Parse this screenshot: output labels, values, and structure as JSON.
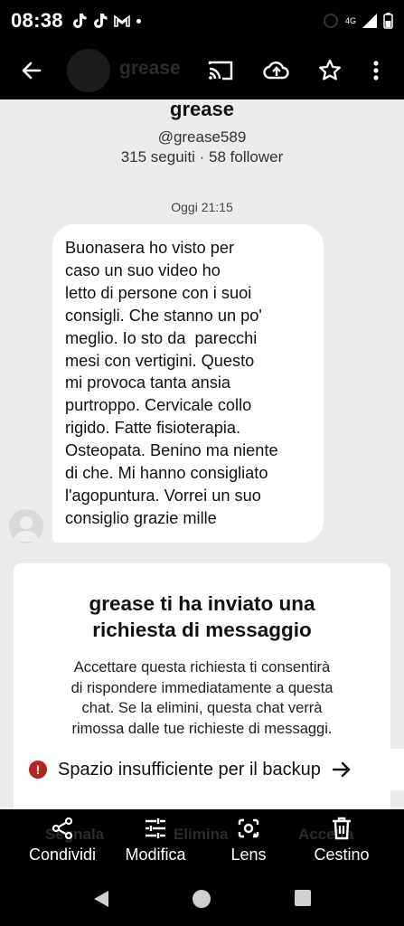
{
  "status_bar": {
    "time": "08:38",
    "left_icons": [
      "tiktok-icon",
      "tiktok-icon",
      "gmail-icon",
      "dot-icon"
    ],
    "network": "4G"
  },
  "top_bar": {
    "ghost_title": "grease",
    "icons": [
      "back-arrow-icon",
      "cast-icon",
      "cloud-upload-icon",
      "star-icon",
      "more-vert-icon"
    ]
  },
  "profile": {
    "name": "grease",
    "handle": "@grease589",
    "stats": "315 seguiti · 58 follower"
  },
  "conversation": {
    "timestamp": "Oggi 21:15",
    "message_lines": [
      "Buonasera ho visto per",
      "caso un suo video ho",
      "letto di persone con i suoi",
      "consigli. Che stanno un po'",
      "meglio. Io sto da  parecchi",
      "mesi con vertigini. Questo",
      "mi provoca tanta ansia",
      "purtroppo. Cervicale collo",
      "rigido. Fatte fisioterapia.",
      "Osteopata. Benino ma niente",
      "di che. Mi hanno consigliato",
      "l'agopuntura. Vorrei un suo",
      "consiglio grazie mille"
    ]
  },
  "request": {
    "title_lines": [
      "grease ti ha inviato una",
      "richiesta di messaggio"
    ],
    "body_lines": [
      "Accettare questa richiesta ti consentirà",
      "di rispondere immediatamente a questa",
      "chat. Se la elimini, questa chat verrà",
      "rimossa dalle tue richieste di messaggi."
    ]
  },
  "toast": {
    "icon_text": "!",
    "text": "Spazio insufficiente per il backup",
    "accent": "#b3261e"
  },
  "ghost_actions": {
    "report": "Segnala",
    "delete": "Elimina",
    "accept": "Accetta"
  },
  "bottom_actions": [
    {
      "label": "Condividi",
      "icon": "share-icon"
    },
    {
      "label": "Modifica",
      "icon": "tune-icon"
    },
    {
      "label": "Lens",
      "icon": "lens-icon"
    },
    {
      "label": "Cestino",
      "icon": "trash-icon"
    }
  ],
  "nav_bar": [
    "back-icon",
    "home-icon",
    "recents-icon"
  ]
}
